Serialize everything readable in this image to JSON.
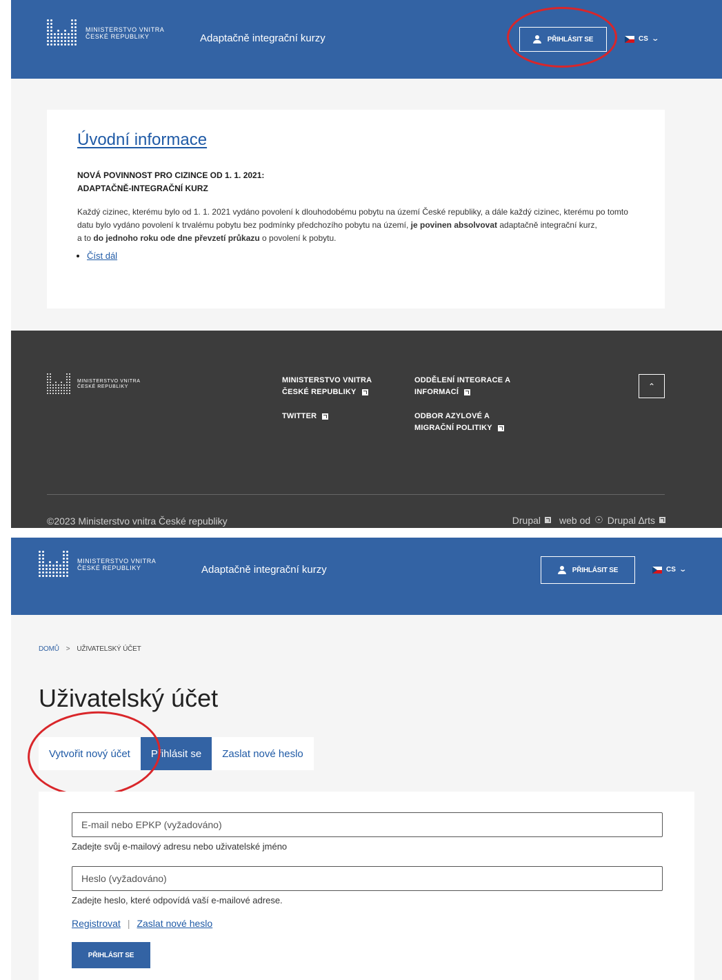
{
  "brand": {
    "logo_line1": "Ministerstvo vnitra",
    "logo_line2": "České republiky",
    "site_title": "Adaptačně integrační kurzy"
  },
  "header": {
    "login_label": "PŘIHLÁSIT SE",
    "language": "CS"
  },
  "intro": {
    "title": "Úvodní informace",
    "kicker_line1": "NOVÁ POVINNOST PRO CIZINCE OD 1. 1. 2021:",
    "kicker_line2": "ADAPTAČNĚ-INTEGRAČNÍ KURZ",
    "p1_part1": "Každý cizinec, kterému bylo od 1. 1. 2021 vydáno povolení k dlouhodobému pobytu na území České republiky, a dále každý cizinec, kterému po tomto datu bylo vydáno povolení k trvalému pobytu bez podmínky předchozího pobytu na území, ",
    "p1_bold": "je povinen absolvovat",
    "p1_part2": " adaptačně integrační kurz,",
    "p2_part1": "a to ",
    "p2_bold": "do jednoho roku ode dne převzetí průkazu",
    "p2_part2": " o povolení k pobytu.",
    "read_more": "Číst dál"
  },
  "footer": {
    "col1": {
      "link1": "Ministerstvo vnitra České republiky",
      "link2": "Twitter"
    },
    "col2": {
      "link1": "Oddělení integrace a informací",
      "link2": "Odbor azylové a migrační politiky"
    },
    "copyright": "©2023 Ministerstvo vnitra České republiky",
    "credit_drupal": "Drupal",
    "credit_web_od": "web od",
    "credit_arts": "Drupal ∆rts",
    "scroll_top_icon": "chevron-up-icon"
  },
  "account": {
    "breadcrumb_home": "DOMŮ",
    "breadcrumb_sep": ">",
    "breadcrumb_current": "UŽIVATELSKÝ ÚČET",
    "page_title": "Uživatelský účet",
    "tabs": [
      {
        "label": "Vytvořit nový účet",
        "active": false
      },
      {
        "label": "Přihlásit se",
        "active": true
      },
      {
        "label": "Zaslat nové heslo",
        "active": false
      }
    ],
    "email_placeholder": "E-mail nebo EPKP (vyžadováno)",
    "email_help": "Zadejte svůj e-mailový adresu nebo uživatelské jméno",
    "password_placeholder": "Heslo (vyžadováno)",
    "password_help": "Zadejte heslo, které odpovídá vaší e-mailové adrese.",
    "register_link": "Registrovat",
    "link_sep": "|",
    "reset_link": "Zaslat nové heslo",
    "submit_label": "PŘIHLÁSIT SE"
  },
  "colors": {
    "header_blue": "#3363a4",
    "footer_dark": "#3c3c3c",
    "annotation_red": "#d9262a"
  }
}
